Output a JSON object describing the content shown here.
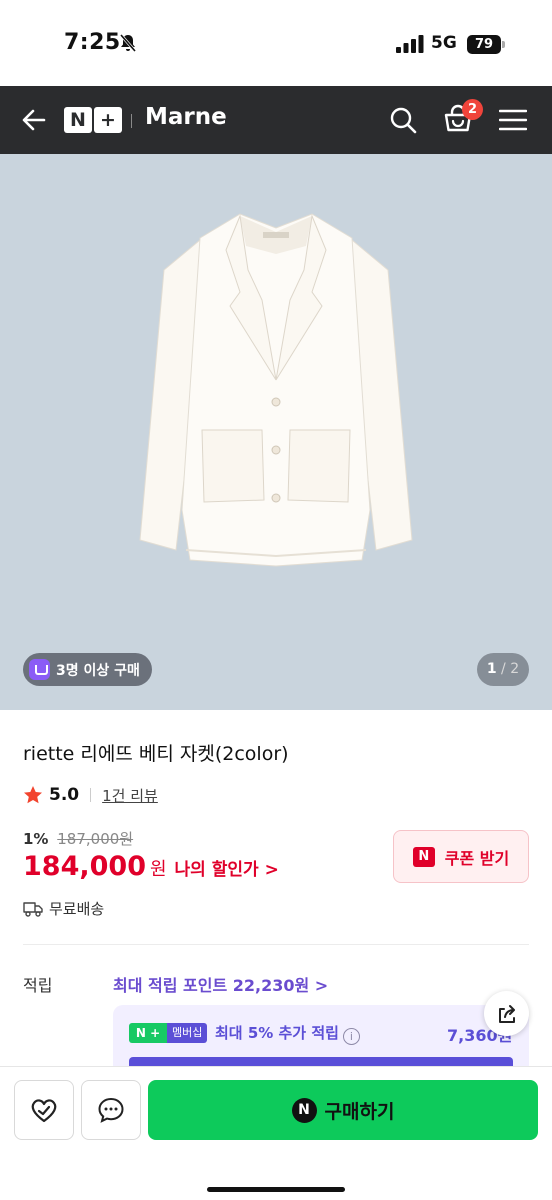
{
  "status_bar": {
    "time": "7:25",
    "network": "5G",
    "battery": "79"
  },
  "header": {
    "logo_symbol": "N+",
    "brand": "Marne",
    "cart_count": "2",
    "icons": [
      "back-arrow-icon",
      "search-icon",
      "shopping-bag-icon",
      "hamburger-menu-icon"
    ]
  },
  "hero": {
    "group_badge": "3명 이상 구매",
    "counter_current": "1",
    "counter_separator": " / ",
    "counter_total": "2",
    "background": "#c9d4dd"
  },
  "product": {
    "title": "riette 리에뜨 베티 자켓(2color)",
    "rating": "5.0",
    "review_link": "1건 리뷰",
    "discount_rate": "1%",
    "original_price": "187,000원",
    "sale_price": "184,000",
    "price_unit": "원",
    "my_discount": "나의 할인가 >",
    "coupon_mark": "N",
    "coupon_label": "쿠폰 받기",
    "shipping": "무료배송"
  },
  "points": {
    "label": "적립",
    "max_points": "최대 적립 포인트 22,230원 >",
    "member_badge_n": "N +",
    "member_badge_tag": "멤버십",
    "member_text": "최대 5% 추가 적립",
    "member_amount": "7,360원"
  },
  "bottom_bar": {
    "buy_mark": "N",
    "buy_label": "구매하기"
  },
  "colors": {
    "header_bg": "#2b2c2e",
    "price_red": "#e0002a",
    "buy_green": "#0dca5b",
    "member_purple": "#5b4fd6"
  }
}
